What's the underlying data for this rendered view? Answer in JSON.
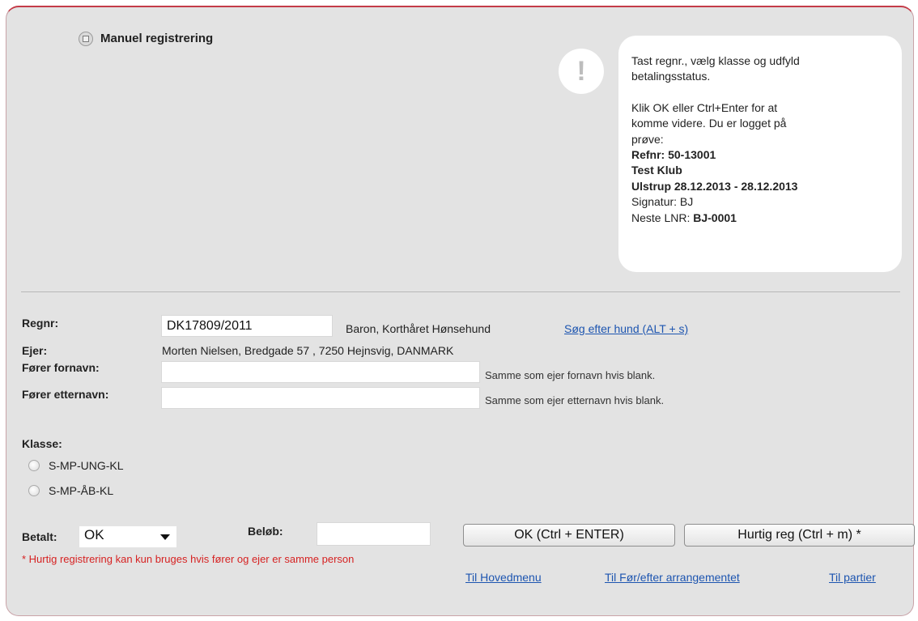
{
  "page": {
    "title": "Manuel registrering"
  },
  "info": {
    "line1": "Tast regnr., vælg klasse og udfyld",
    "line2": "betalingsstatus.",
    "line3": "Klik OK eller Ctrl+Enter for at",
    "line4": "komme videre. Du er logget på",
    "line5": "prøve:",
    "refnr": "Refnr: 50-13001",
    "club": "Test Klub",
    "event": "Ulstrup 28.12.2013 - 28.12.2013",
    "signature": "Signatur: BJ",
    "next_lnr_label": "Neste LNR: ",
    "next_lnr_value": "BJ-0001"
  },
  "form": {
    "regnr_label": "Regnr:",
    "regnr_value": "DK17809/2011",
    "dog_name": "Baron, Korthåret Hønsehund",
    "search_link": "Søg efter hund (ALT + s)",
    "owner_label": "Ejer:",
    "owner_value": "Morten Nielsen, Bredgade 57 , 7250 Hejnsvig, DANMARK",
    "handler_firstname_label": "Fører fornavn:",
    "handler_firstname_value": "",
    "handler_firstname_hint": "Samme som ejer fornavn hvis blank.",
    "handler_lastname_label": "Fører etternavn:",
    "handler_lastname_value": "",
    "handler_lastname_hint": "Samme som ejer etternavn hvis blank.",
    "class_label": "Klasse:",
    "classes": [
      "S-MP-UNG-KL",
      "S-MP-ÅB-KL"
    ],
    "paid_label": "Betalt:",
    "paid_selected": "OK",
    "amount_label": "Beløb:",
    "amount_value": ""
  },
  "buttons": {
    "ok": "OK (Ctrl + ENTER)",
    "quick": "Hurtig reg (Ctrl + m) *"
  },
  "note": "* Hurtig registrering kan kun bruges hvis fører og ejer er samme person",
  "links": {
    "main_menu": "Til Hovedmenu",
    "before_after": "Til Før/efter arrangementet",
    "parties": "Til partier"
  },
  "colors": {
    "panel_bg": "#e3e3e3",
    "accent_border": "#c43b48",
    "link": "#1d55b0",
    "note": "#d62222"
  }
}
